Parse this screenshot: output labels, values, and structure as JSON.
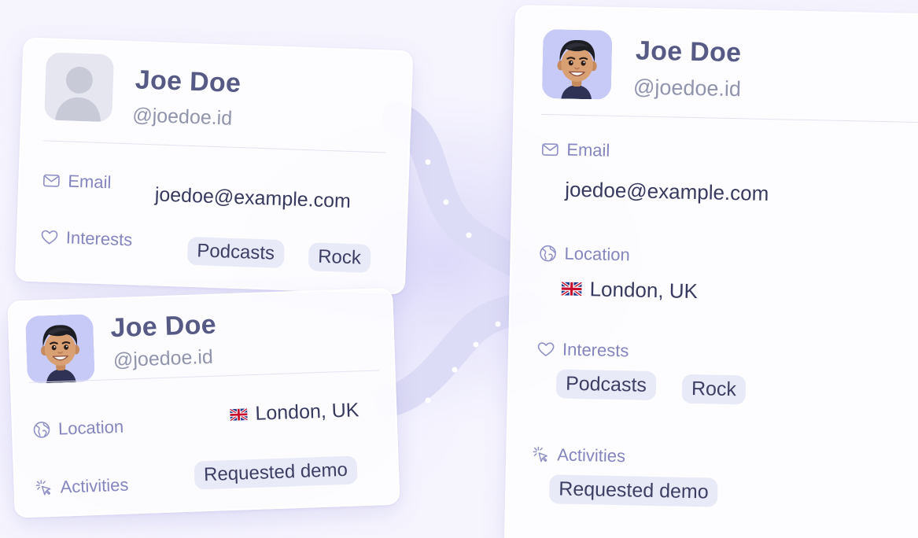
{
  "cards": {
    "top_left": {
      "name": "Joe Doe",
      "handle": "@joedoe.id",
      "email_label": "Email",
      "email_value": "joedoe@example.com",
      "interests_label": "Interests",
      "interests": [
        "Podcasts",
        "Rock"
      ]
    },
    "bottom_left": {
      "name": "Joe Doe",
      "handle": "@joedoe.id",
      "location_label": "Location",
      "location_value": "London, UK",
      "activities_label": "Activities",
      "activity": "Requested demo"
    },
    "right": {
      "name": "Joe Doe",
      "handle": "@joedoe.id",
      "email_label": "Email",
      "email_value": "joedoe@example.com",
      "location_label": "Location",
      "location_value": "London, UK",
      "interests_label": "Interests",
      "interests": [
        "Podcasts",
        "Rock"
      ],
      "activities_label": "Activities",
      "activity": "Requested demo"
    }
  },
  "icons": [
    "mail-icon",
    "heart-icon",
    "globe-icon",
    "cursor-click-icon",
    "uk-flag-icon",
    "avatar-placeholder-icon",
    "avatar-memoji-icon"
  ],
  "colors": {
    "accent_label": "#8585bf",
    "name": "#565a85",
    "value": "#373a5e",
    "tag_bg": "#e9eaf7",
    "background": "#f6f5fe"
  }
}
